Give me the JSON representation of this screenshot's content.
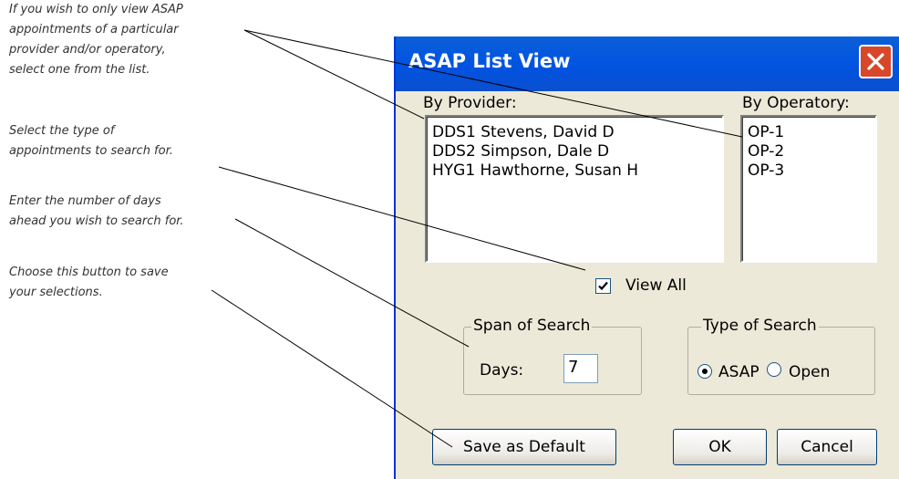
{
  "annotations": [
    {
      "lines": [
        "If you wish to only view ASAP",
        "appointments of a particular",
        "provider and/or operatory,",
        "select one from the list."
      ]
    },
    {
      "lines": [
        "Select the type of",
        "appointments to search for."
      ]
    },
    {
      "lines": [
        "Enter the number of days",
        "ahead you wish to search for."
      ]
    },
    {
      "lines": [
        "Choose this button to save",
        "your selections."
      ]
    }
  ],
  "dialog": {
    "title": "ASAP List View",
    "close_icon": "close-icon",
    "provider_label": "By Provider:",
    "providers": [
      "DDS1  Stevens, David D",
      "DDS2  Simpson, Dale D",
      "HYG1  Hawthorne, Susan H"
    ],
    "operatory_label": "By Operatory:",
    "operatories": [
      "OP-1",
      "OP-2",
      "OP-3"
    ],
    "view_all": {
      "label": "View All",
      "checked": true
    },
    "span_group": {
      "title": "Span of Search",
      "days_label": "Days:",
      "days_value": "7"
    },
    "type_group": {
      "title": "Type of Search",
      "options": [
        {
          "label": "ASAP",
          "selected": true
        },
        {
          "label": "Open",
          "selected": false
        }
      ]
    },
    "buttons": {
      "save_default": "Save as Default",
      "ok": "OK",
      "cancel": "Cancel"
    }
  },
  "colors": {
    "titlebar": "#0054e3",
    "dialog_bg": "#ece9d8",
    "close_button": "#d9472b"
  }
}
